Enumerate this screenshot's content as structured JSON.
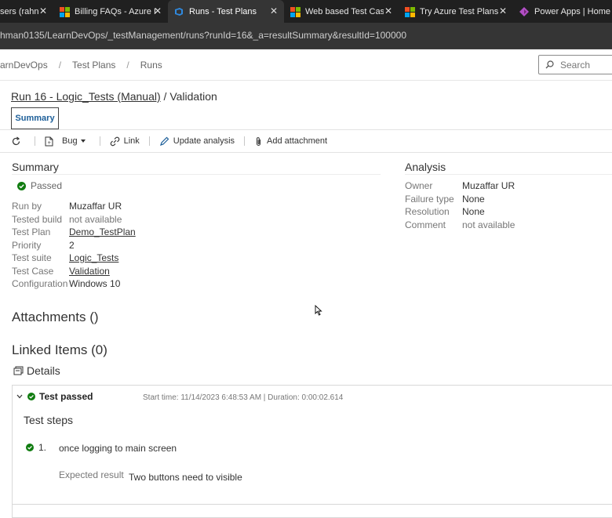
{
  "browser": {
    "tabs": [
      {
        "label": "sers (rahn",
        "icon": "azure-devops-icon"
      },
      {
        "label": "Billing FAQs - Azure I",
        "icon": "microsoft-logo-icon"
      },
      {
        "label": "Runs - Test Plans",
        "icon": "azure-devops-icon",
        "active": true
      },
      {
        "label": "Web based Test Case",
        "icon": "microsoft-logo-icon"
      },
      {
        "label": "Try Azure Test Plans f",
        "icon": "microsoft-logo-icon"
      },
      {
        "label": "Power Apps | Home",
        "icon": "power-apps-icon"
      }
    ],
    "url": "hman0135/LearnDevOps/_testManagement/runs?runId=16&_a=resultSummary&resultId=100000"
  },
  "breadcrumb": {
    "items": [
      "arnDevOps",
      "Test Plans",
      "Runs"
    ],
    "separator": "/"
  },
  "search": {
    "placeholder": "Search"
  },
  "run": {
    "title_link": "Run 16 - Logic_Tests (Manual)",
    "title_rest": " / Validation",
    "tab_summary": "Summary"
  },
  "toolbar": {
    "bug_label": "Bug",
    "link_label": "Link",
    "update_label": "Update analysis",
    "attach_label": "Add attachment"
  },
  "summary": {
    "heading": "Summary",
    "status": "Passed",
    "fields": [
      {
        "key": "Run by",
        "value": "Muzaffar UR"
      },
      {
        "key": "Tested build",
        "value": "not available"
      },
      {
        "key": "Test Plan",
        "value": "Demo_TestPlan"
      },
      {
        "key": "Priority",
        "value": "2"
      },
      {
        "key": "Test suite",
        "value": "Logic_Tests"
      },
      {
        "key": "Test Case",
        "value": "Validation"
      },
      {
        "key": "Configuration",
        "value": "Windows 10"
      }
    ]
  },
  "analysis": {
    "heading": "Analysis",
    "fields": [
      {
        "key": "Owner",
        "value": "Muzaffar UR"
      },
      {
        "key": "Failure type",
        "value": "None"
      },
      {
        "key": "Resolution",
        "value": "None"
      },
      {
        "key": "Comment",
        "value": "not available"
      }
    ]
  },
  "attachments": {
    "heading": "Attachments ()"
  },
  "linked": {
    "heading": "Linked Items (0)"
  },
  "details": {
    "heading": "Details",
    "result_label": "Test passed",
    "timing": "Start time: 11/14/2023 6:48:53 AM | Duration: 0:00:02.614",
    "steps_heading": "Test steps",
    "steps": [
      {
        "number": "1.",
        "action": "once logging to main screen",
        "expected_label": "Expected result",
        "expected": "Two buttons need to visible"
      }
    ]
  },
  "colors": {
    "pass": "#107c10",
    "link": "#1d5f99"
  }
}
